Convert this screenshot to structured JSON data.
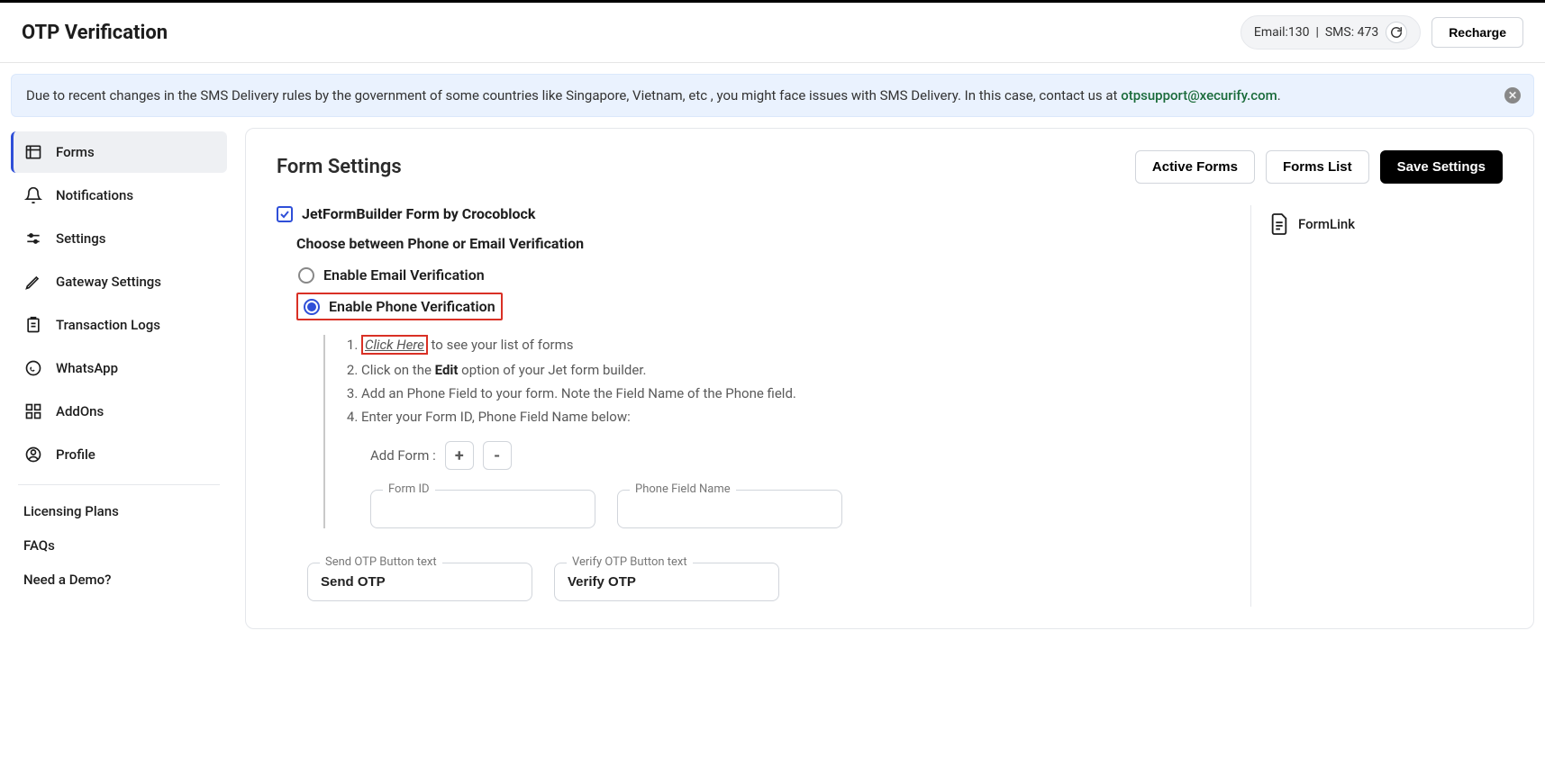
{
  "header": {
    "title": "OTP Verification",
    "credits_email_label": "Email:",
    "credits_email_value": "130",
    "credits_sms_label": "SMS:",
    "credits_sms_value": "473",
    "recharge_label": "Recharge"
  },
  "notice": {
    "text": "Due to recent changes in the SMS Delivery rules by the government of some countries like Singapore, Vietnam, etc , you might face issues with SMS Delivery. In this case, contact us at ",
    "link_text": "otpsupport@xecurify.com",
    "suffix": "."
  },
  "sidebar": {
    "items": [
      {
        "label": "Forms",
        "active": true
      },
      {
        "label": "Notifications"
      },
      {
        "label": "Settings"
      },
      {
        "label": "Gateway Settings"
      },
      {
        "label": "Transaction Logs"
      },
      {
        "label": "WhatsApp"
      },
      {
        "label": "AddOns"
      },
      {
        "label": "Profile"
      }
    ],
    "links": [
      {
        "label": "Licensing Plans"
      },
      {
        "label": "FAQs"
      },
      {
        "label": "Need a Demo?"
      }
    ]
  },
  "main": {
    "title": "Form Settings",
    "buttons": {
      "active_forms": "Active Forms",
      "forms_list": "Forms List",
      "save_settings": "Save Settings"
    },
    "checkbox_label": "JetFormBuilder Form by Crocoblock",
    "section_title": "Choose between Phone or Email Verification",
    "radio_email": "Enable Email Verification",
    "radio_phone": "Enable Phone Verification",
    "instructions": {
      "step1_link": "Click Here",
      "step1_rest": " to see your list of forms",
      "step2_pre": "Click on the ",
      "step2_bold": "Edit",
      "step2_rest": " option of your Jet form builder.",
      "step3": "Add an Phone Field to your form. Note the Field Name of the Phone field.",
      "step4": "Enter your Form ID, Phone Field Name below:"
    },
    "add_form_label": "Add Form :",
    "add_btn": "+",
    "remove_btn": "-",
    "fields": {
      "form_id_label": "Form ID",
      "form_id_value": "",
      "phone_field_label": "Phone Field Name",
      "phone_field_value": "",
      "send_otp_label": "Send OTP Button text",
      "send_otp_value": "Send OTP",
      "verify_otp_label": "Verify OTP Button text",
      "verify_otp_value": "Verify OTP"
    },
    "formlink_label": "FormLink"
  }
}
